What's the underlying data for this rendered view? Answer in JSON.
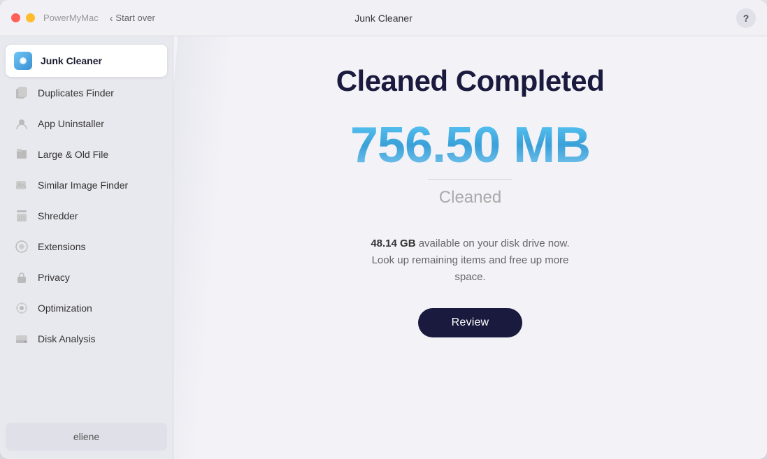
{
  "titlebar": {
    "app_name": "PowerMyMac",
    "start_over_label": "Start over",
    "title": "Junk Cleaner",
    "help_label": "?"
  },
  "sidebar": {
    "items": [
      {
        "id": "junk-cleaner",
        "label": "Junk Cleaner",
        "icon": "🔵",
        "active": true
      },
      {
        "id": "duplicates-finder",
        "label": "Duplicates Finder",
        "icon": "📋",
        "active": false
      },
      {
        "id": "app-uninstaller",
        "label": "App Uninstaller",
        "icon": "👤",
        "active": false
      },
      {
        "id": "large-old-file",
        "label": "Large & Old File",
        "icon": "💼",
        "active": false
      },
      {
        "id": "similar-image-finder",
        "label": "Similar Image Finder",
        "icon": "🖼",
        "active": false
      },
      {
        "id": "shredder",
        "label": "Shredder",
        "icon": "🗂",
        "active": false
      },
      {
        "id": "extensions",
        "label": "Extensions",
        "icon": "🔌",
        "active": false
      },
      {
        "id": "privacy",
        "label": "Privacy",
        "icon": "🔒",
        "active": false
      },
      {
        "id": "optimization",
        "label": "Optimization",
        "icon": "⚙",
        "active": false
      },
      {
        "id": "disk-analysis",
        "label": "Disk Analysis",
        "icon": "💾",
        "active": false
      }
    ],
    "user_label": "eliene"
  },
  "main": {
    "cleaned_title": "Cleaned Completed",
    "amount_value": "756.50 MB",
    "amount_label": "Cleaned",
    "disk_info_bold": "48.14 GB",
    "disk_info_text": " available on your disk drive now. Look up remaining items and free up more space.",
    "review_button_label": "Review"
  }
}
